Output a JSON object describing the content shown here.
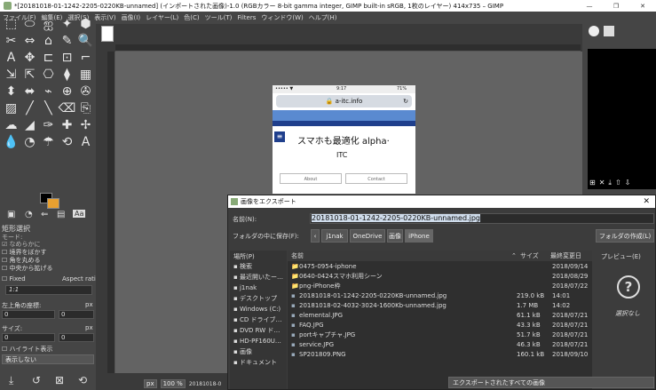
{
  "window": {
    "title": "*[20181018-01-1242-2205-0220KB-unnamed] (インポートされた画像)-1.0 (RGBカラー 8-bit gamma integer, GIMP built-in sRGB, 1枚のレイヤー) 414x735 – GIMP",
    "controls": [
      "—",
      "❐",
      "✕"
    ]
  },
  "menu": [
    "ファイル(F)",
    "編集(E)",
    "選択(S)",
    "表示(V)",
    "画像(I)",
    "レイヤー(L)",
    "色(C)",
    "ツール(T)",
    "Filters",
    "ウィンドウ(W)",
    "ヘルプ(H)"
  ],
  "tools": [
    "⬚",
    "⬭",
    "ஐ",
    "✦",
    "⬢",
    "✂",
    "⇔",
    "⌂",
    "✎",
    "🔍",
    "A",
    "✥",
    "⊏",
    "⊡",
    "⌐",
    "⇲",
    "⇱",
    "⎔",
    "⧫",
    "▦",
    "⬍",
    "⬌",
    "⌁",
    "⊕",
    "✇",
    "▨",
    "╱",
    "╲",
    "⌫",
    "⎘",
    "☁",
    "◢",
    "✑",
    "✚",
    "✢",
    "💧",
    "◔",
    "☂",
    "⟲",
    "A"
  ],
  "tool_options": {
    "section": "矩形選択",
    "mode_label": "モード:",
    "antialias": "なめらかに",
    "feather": "境界をぼかす",
    "round": "角を丸める",
    "expand": "中央から拡げる",
    "fixed": "Fixed",
    "aspect": "Aspect rati",
    "ratio": "1:1",
    "position_label": "左上角の座標:",
    "unit1": "px",
    "pos_x": "0",
    "pos_y": "0",
    "size_label": "サイズ:",
    "unit2": "px",
    "size_x": "0",
    "size_y": "0",
    "highlight": "ハイライト表示",
    "guides": "表示しない"
  },
  "status": {
    "unit": "px",
    "zoom": "100 %",
    "file": "20181018-0"
  },
  "phone": {
    "status_left": "••••• ▼",
    "time": "9:17",
    "battery": "71%",
    "url": "a-itc.info",
    "headline": "スマホも最適化 alpha·",
    "sub": "ITC",
    "btn1": "About",
    "btn2": "Contact"
  },
  "dialog": {
    "title": "画像をエクスポート",
    "name_label": "名前(N):",
    "filename": "20181018-01-1242-2205-0220KB-unnamed.jpg",
    "folder_label": "フォルダの中に保存(F):",
    "path": [
      "j1nak",
      "OneDrive",
      "画像",
      "iPhone"
    ],
    "create_folder": "フォルダの作成(L)",
    "places_header": "場所(P)",
    "name_header": "名前",
    "size_header": "サイズ",
    "date_header": "最終変更日",
    "preview_header": "プレビュー(E)",
    "no_selection": "選択なし",
    "filter": "エクスポートされたすべての画像",
    "places": [
      "検索",
      "最近開いたー…",
      "j1nak",
      "デスクトップ",
      "Windows (C:)",
      "CD ドライブ…",
      "DVD RW ド…",
      "HD-PF160U…",
      "画像",
      "ドキュメント"
    ],
    "files": [
      {
        "name": "0475-0954-iphone",
        "size": "",
        "date": "2018/09/14",
        "icon": "📁"
      },
      {
        "name": "0640-0424スマホ利用シーン",
        "size": "",
        "date": "2018/08/29",
        "icon": "📁"
      },
      {
        "name": "png-iPhone枠",
        "size": "",
        "date": "2018/07/22",
        "icon": "📁"
      },
      {
        "name": "20181018-01-1242-2205-0220KB-unnamed.jpg",
        "size": "219.0 kB",
        "date": "14:01",
        "icon": "▪"
      },
      {
        "name": "20181018-02-4032-3024-1600Kb-unnamed.jpg",
        "size": "1.7 MB",
        "date": "14:02",
        "icon": "▪"
      },
      {
        "name": "elemental.JPG",
        "size": "61.1 kB",
        "date": "2018/07/21",
        "icon": "▪"
      },
      {
        "name": "FAQ.JPG",
        "size": "43.3 kB",
        "date": "2018/07/21",
        "icon": "▪"
      },
      {
        "name": "portキャプチャ.JPG",
        "size": "51.7 kB",
        "date": "2018/07/21",
        "icon": "▪"
      },
      {
        "name": "service.JPG",
        "size": "46.3 kB",
        "date": "2018/07/21",
        "icon": "▪"
      },
      {
        "name": "SP201809.PNG",
        "size": "160.1 kB",
        "date": "2018/09/10",
        "icon": "▪"
      }
    ]
  },
  "colors": {
    "accent": "#e8a030",
    "selection": "#c4d6ea",
    "dialog_bg": "#3c3c3c",
    "phone_nav": "#1f3f8c"
  }
}
